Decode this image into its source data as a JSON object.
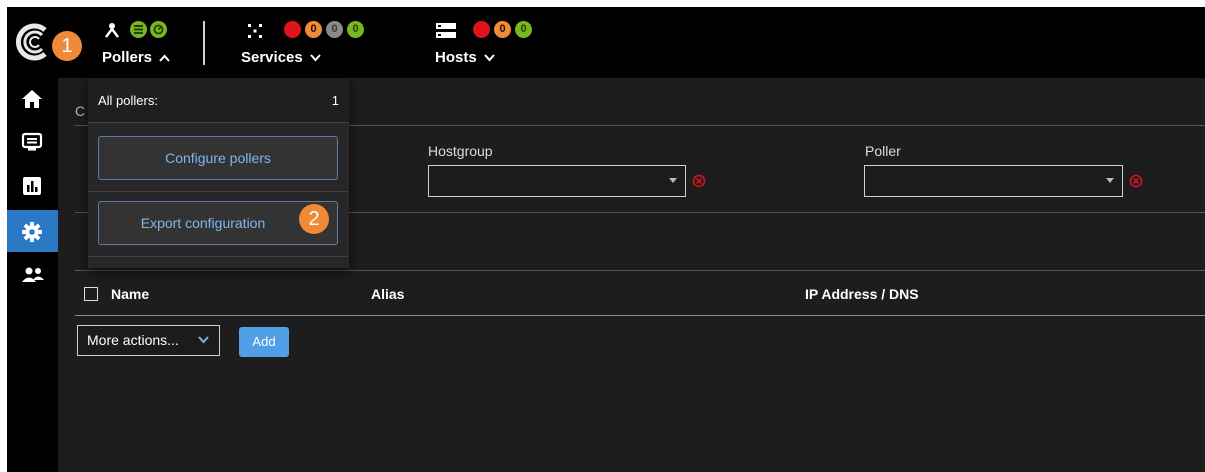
{
  "topbar": {
    "step1": "1",
    "pollers": {
      "label": "Pollers",
      "icon": "poller-icon",
      "status_colors": [
        "#7ab71f",
        "#7ab71f"
      ]
    },
    "services": {
      "label": "Services",
      "icon": "services-icon",
      "counts": [
        "0",
        "0",
        "0",
        "0"
      ]
    },
    "hosts": {
      "label": "Hosts",
      "icon": "hosts-icon",
      "counts": [
        "0",
        "0",
        "0"
      ]
    }
  },
  "sidebar": {
    "items": [
      {
        "icon": "home-icon"
      },
      {
        "icon": "monitor-icon"
      },
      {
        "icon": "reporting-icon"
      },
      {
        "icon": "gear-icon",
        "active": true
      },
      {
        "icon": "users-icon"
      }
    ]
  },
  "main": {
    "crumb": "C",
    "filters": [
      {
        "label": "Hostgroup",
        "value": ""
      },
      {
        "label": "Poller",
        "value": ""
      }
    ],
    "table": {
      "headers": [
        "Name",
        "Alias",
        "IP Address / DNS"
      ]
    },
    "more_actions": "More actions...",
    "add": "Add"
  },
  "dropdown": {
    "title": "All pollers:",
    "count": "1",
    "configure": "Configure pollers",
    "export": "Export configuration",
    "step2": "2"
  },
  "colors": {
    "accent": "#2b78c5",
    "badge": "#ef8a38",
    "critical": "#e0121c",
    "warning": "#ef8a38",
    "unknown": "#8a8a8a",
    "ok": "#7ab71f"
  }
}
